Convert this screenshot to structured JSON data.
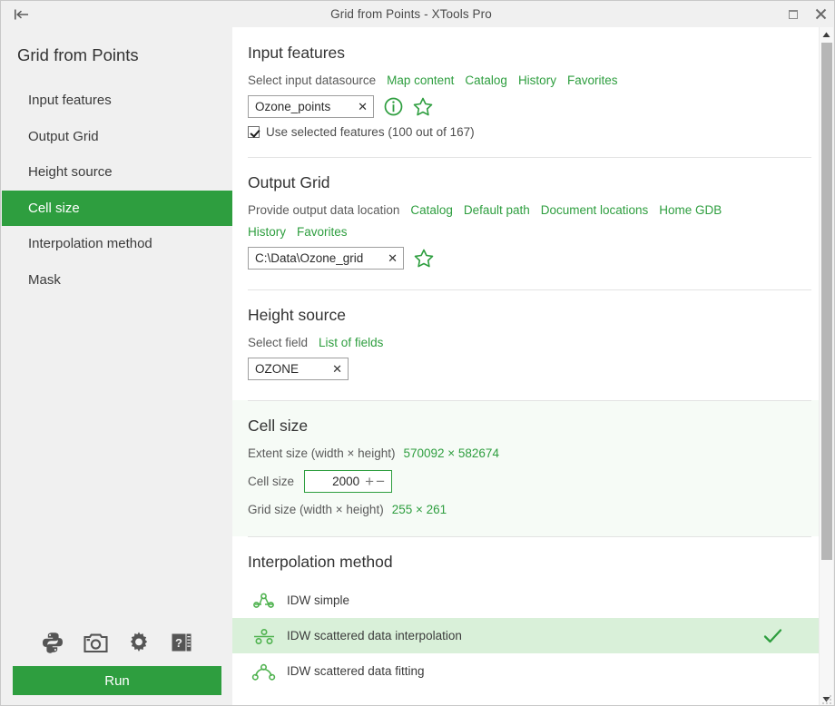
{
  "titlebar": {
    "back_icon": "collapse-left-icon",
    "title": "Grid from Points - XTools Pro",
    "restore_label": "",
    "close_label": "✕"
  },
  "sidebar": {
    "title": "Grid from Points",
    "items": [
      {
        "label": "Input features",
        "active": false
      },
      {
        "label": "Output Grid",
        "active": false
      },
      {
        "label": "Height source",
        "active": false
      },
      {
        "label": "Cell size",
        "active": true
      },
      {
        "label": "Interpolation method",
        "active": false
      },
      {
        "label": "Mask",
        "active": false
      }
    ],
    "tools": [
      {
        "name": "python-icon"
      },
      {
        "name": "camera-icon"
      },
      {
        "name": "gear-icon"
      },
      {
        "name": "help-notebook-icon"
      }
    ],
    "run_label": "Run"
  },
  "input_features": {
    "title": "Input features",
    "prompt": "Select input datasource",
    "links": [
      "Map content",
      "Catalog",
      "History",
      "Favorites"
    ],
    "datasource_value": "Ozone_points",
    "clear_label": "✕",
    "info_icon": "info-icon",
    "favorite_icon": "star-icon",
    "checkbox_checked": true,
    "checkbox_label": "Use selected features (100 out of 167)"
  },
  "output_grid": {
    "title": "Output Grid",
    "prompt": "Provide output data location",
    "links_row1": [
      "Catalog",
      "Default path",
      "Document locations",
      "Home GDB"
    ],
    "links_row2": [
      "History",
      "Favorites"
    ],
    "path_value": "C:\\Data\\Ozone_grid",
    "clear_label": "✕",
    "favorite_icon": "star-icon"
  },
  "height_source": {
    "title": "Height source",
    "prompt": "Select field",
    "link": "List of fields",
    "field_value": "OZONE",
    "clear_label": "✕"
  },
  "cell_size": {
    "title": "Cell size",
    "extent_label": "Extent size (width × height)",
    "extent_value": "570092 × 582674",
    "cell_label": "Cell size",
    "cell_value": "2000",
    "increment_label": "+",
    "decrement_label": "−",
    "grid_label": "Grid size (width × height)",
    "grid_value": "255 × 261"
  },
  "interpolation": {
    "title": "Interpolation method",
    "methods": [
      {
        "label": "IDW simple",
        "icon": "nodes-link-icon",
        "selected": false
      },
      {
        "label": "IDW scattered data interpolation",
        "icon": "scatter-line-icon",
        "selected": true
      },
      {
        "label": "IDW scattered data fitting",
        "icon": "arc-nodes-icon",
        "selected": false
      }
    ],
    "check_glyph": "✓"
  },
  "colors": {
    "accent_green": "#2e9e3f",
    "selection_green": "#d9f0d9",
    "section_highlight": "#f6fbf6",
    "sidebar_bg": "#f0f0f0"
  }
}
